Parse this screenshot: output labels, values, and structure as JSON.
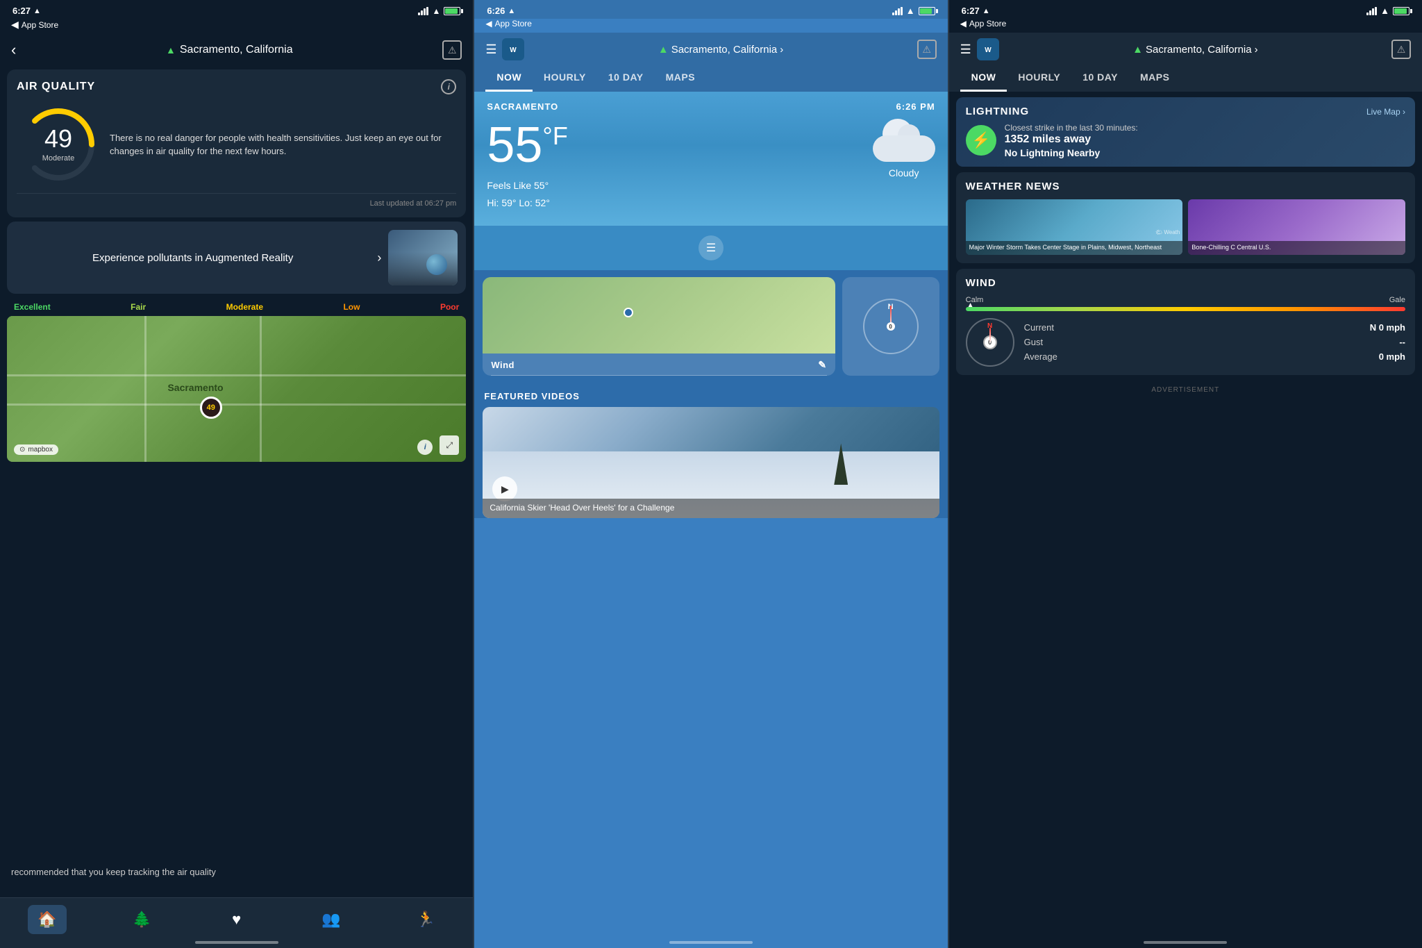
{
  "left": {
    "status": {
      "time": "6:27",
      "location_arrow": "▲",
      "app_store": "App Store"
    },
    "nav": {
      "back_label": "◀",
      "title": "Sacramento, California",
      "warning_icon": "⚠"
    },
    "air_quality": {
      "title": "AIR QUALITY",
      "info_icon": "i",
      "value": "49",
      "label": "Moderate",
      "description": "There is no real danger for people with health sensitivities. Just keep an eye out for changes in air quality for the next few hours.",
      "updated": "Last updated at 06:27 pm"
    },
    "ar_section": {
      "text": "Experience pollutants in Augmented Reality",
      "chevron": "›"
    },
    "scale": {
      "excellent": "Excellent",
      "fair": "Fair",
      "moderate": "Moderate",
      "low": "Low",
      "poor": "Poor"
    },
    "map": {
      "location_label": "Sacramento",
      "value_label": "49",
      "mapbox": "mapbox"
    },
    "tab_bar": {
      "tabs": [
        "🏠",
        "🌲",
        "♥",
        "👥",
        "🏃"
      ],
      "active": 0
    },
    "bottom_text": "recommended that you keep tracking the air quality"
  },
  "middle": {
    "status": {
      "time": "6:26",
      "app_store": "App Store"
    },
    "nav": {
      "location": "Sacramento, California",
      "chevron": "›",
      "warning_icon": "⚠"
    },
    "tabs": [
      "NOW",
      "HOURLY",
      "10 DAY",
      "MAPS"
    ],
    "active_tab": "NOW",
    "weather": {
      "location": "SACRAMENTO",
      "time": "6:26 PM",
      "temperature": "55",
      "unit": "°F",
      "feels_like": "Feels Like 55°",
      "hi_lo": "Hi: 59° Lo: 52°",
      "condition": "Cloudy"
    },
    "wind": {
      "title": "Wind",
      "compass_value": "0"
    },
    "featured_videos": {
      "title": "FEATURED VIDEOS",
      "caption": "California Skier 'Head Over Heels' for a Challenge"
    }
  },
  "right": {
    "status": {
      "time": "6:27",
      "app_store": "App Store"
    },
    "nav": {
      "location": "Sacramento, California",
      "chevron": "›",
      "warning_icon": "⚠"
    },
    "tabs": [
      "NOW",
      "HOURLY",
      "10 DAY",
      "MAPS"
    ],
    "active_tab": "NOW",
    "lightning": {
      "title": "LIGHTNING",
      "live_map": "Live Map ›",
      "subtitle": "Closest strike in the last 30 minutes:",
      "distance": "1352 miles away",
      "status": "No Lightning Nearby",
      "icon": "⚡"
    },
    "weather_news": {
      "title": "WEATHER NEWS",
      "story1": "Major Winter Storm Takes Center Stage in Plains, Midwest, Northeast",
      "story2": "Bone-Chilling C Central U.S.",
      "logo": "🌤 Weath"
    },
    "wind": {
      "title": "WIND",
      "calm_label": "Calm",
      "gale_label": "Gale",
      "north_label": "N",
      "current_label": "Current",
      "current_value": "N 0 mph",
      "gust_label": "Gust",
      "gust_value": "--",
      "average_label": "Average",
      "average_value": "0  mph",
      "compass_value": "0"
    },
    "advertisement": "ADVERTISEMENT"
  }
}
